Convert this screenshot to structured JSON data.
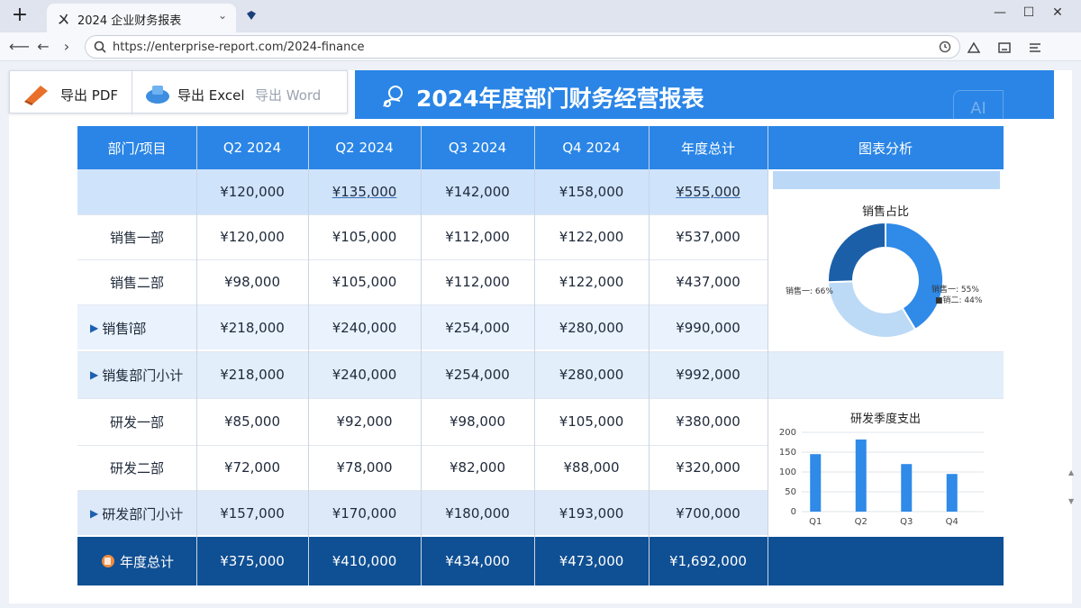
{
  "browser": {
    "tab_title": "2024 企业财务报表",
    "url": "https://enterprise-report.com/2024-finance"
  },
  "toolbar": {
    "export_pdf": "导出 PDF",
    "export_excel": "导出 Excel",
    "export_word": "导出 Word"
  },
  "report": {
    "title": "2024年度部门财务经营报表"
  },
  "table": {
    "headers": [
      "部门/项目",
      "Q2 2024",
      "Q2 2024",
      "Q3 2024",
      "Q4 2024",
      "年度总计",
      "图表分析"
    ],
    "rows": [
      {
        "label": "",
        "cells": [
          "¥120,000",
          "¥135,000",
          "¥142,000",
          "¥158,000",
          "¥555,000"
        ]
      },
      {
        "label": "销售一部",
        "cells": [
          "¥120,000",
          "¥105,000",
          "¥112,000",
          "¥122,000",
          "¥537,000"
        ]
      },
      {
        "label": "销售二部",
        "cells": [
          "¥98,000",
          "¥105,000",
          "¥112,000",
          "¥122,000",
          "¥437,000"
        ]
      },
      {
        "label": "销售î部",
        "cells": [
          "¥218,000",
          "¥240,000",
          "¥254,000",
          "¥280,000",
          "¥990,000"
        ]
      },
      {
        "label": "销隻部门小计",
        "cells": [
          "¥218,000",
          "¥240,000",
          "¥254,000",
          "¥280,000",
          "¥992,000"
        ]
      },
      {
        "label": "研发一部",
        "cells": [
          "¥85,000",
          "¥92,000",
          "¥98,000",
          "¥105,000",
          "¥380,000"
        ]
      },
      {
        "label": "研发二部",
        "cells": [
          "¥72,000",
          "¥78,000",
          "¥82,000",
          "¥88,000",
          "¥320,000"
        ]
      },
      {
        "label": "研发部门小计",
        "cells": [
          "¥157,000",
          "¥170,000",
          "¥180,000",
          "¥193,000",
          "¥700,000"
        ]
      }
    ],
    "total": {
      "label": "年度总计",
      "cells": [
        "¥375,000",
        "¥410,000",
        "¥434,000",
        "¥473,000",
        "¥1,692,000"
      ]
    }
  },
  "chart_data": [
    {
      "type": "pie",
      "title": "销售占比",
      "slices": [
        {
          "label": "销售一: 55%",
          "value": 55,
          "color": "#2f8ae8"
        },
        {
          "label": "■销二: 44%",
          "value": 44,
          "color": "#bcdaf6"
        },
        {
          "label": "销售一: 66%",
          "value": 34,
          "color": "#1b5fa8"
        }
      ]
    },
    {
      "type": "bar",
      "title": "研发季度支出",
      "categories": [
        "Q1",
        "Q2",
        "Q3",
        "Q4"
      ],
      "values": [
        145,
        182,
        120,
        95
      ],
      "ylim": [
        0,
        200
      ],
      "yticks": [
        0,
        50,
        100,
        150,
        200
      ],
      "color": "#2f8ae8",
      "grid": true
    }
  ],
  "badge": {
    "text": "AI"
  },
  "colors": {
    "header_blue": "#2a85e6",
    "total_navy": "#0f4f93",
    "row_highlight": "#cfe3fb",
    "row_light": "#e9f2fd"
  }
}
